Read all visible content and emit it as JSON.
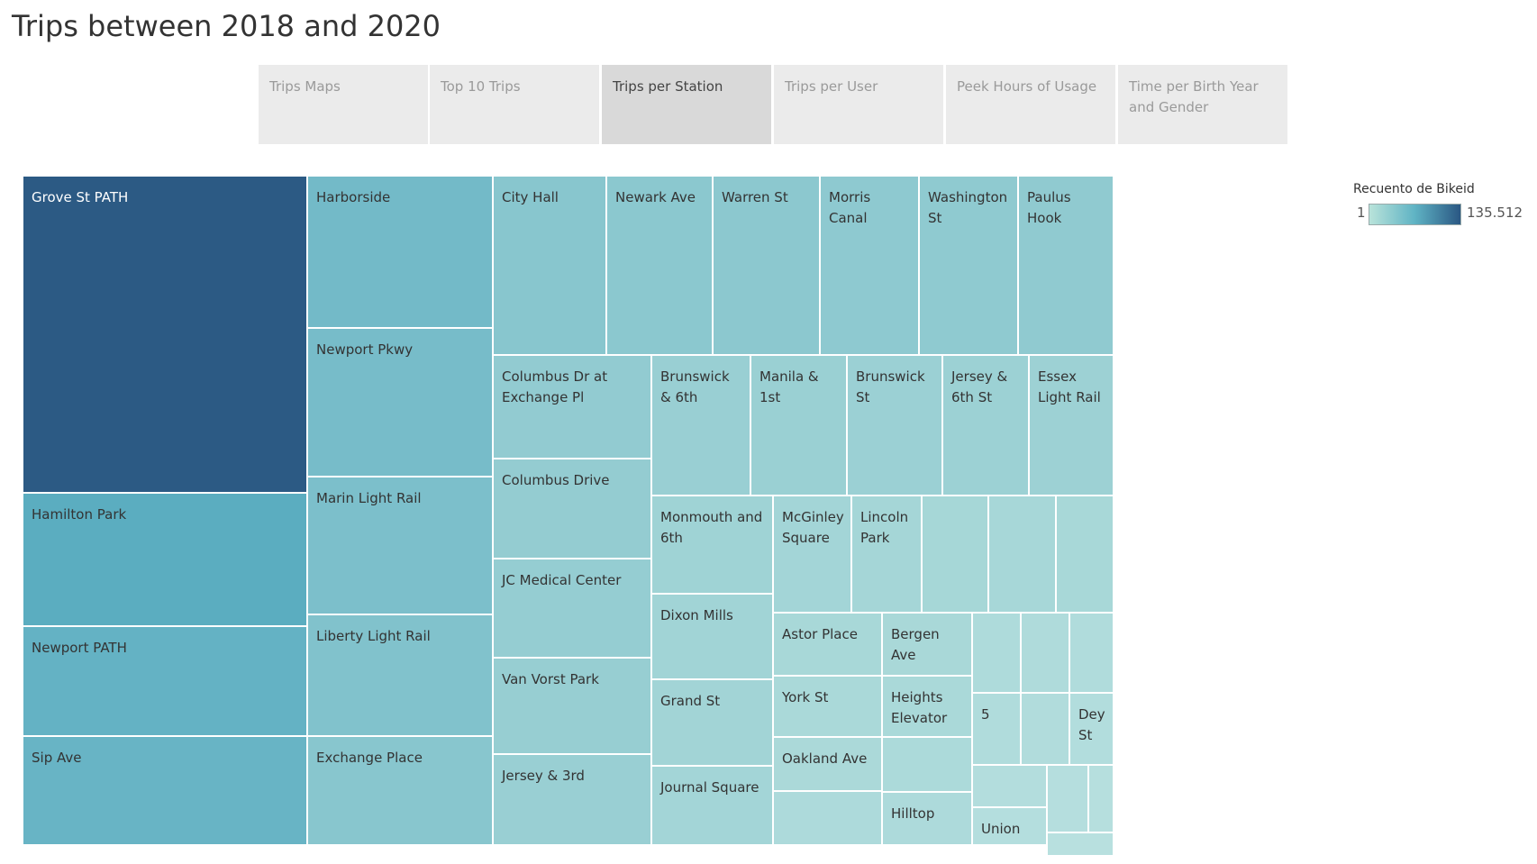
{
  "title": "Trips between 2018 and 2020",
  "tabs": [
    {
      "label": "Trips Maps",
      "active": false
    },
    {
      "label": "Top 10 Trips",
      "active": false
    },
    {
      "label": "Trips per Station",
      "active": true
    },
    {
      "label": "Trips per User",
      "active": false
    },
    {
      "label": "Peek Hours of Usage",
      "active": false
    },
    {
      "label": "Time per Birth Year and Gender",
      "active": false
    }
  ],
  "legend": {
    "title": "Recuento de Bikeid",
    "min": "1",
    "max": "135.512",
    "color_low": "#b9e3da",
    "color_high": "#2a5783"
  },
  "stations": [
    "Grove St PATH",
    "Hamilton Park",
    "Newport PATH",
    "Sip Ave",
    "Harborside",
    "Newport Pkwy",
    "Marin Light Rail",
    "Liberty Light Rail",
    "Exchange Place",
    "City Hall",
    "Newark Ave",
    "Warren St",
    "Morris Canal",
    "Washington St",
    "Paulus Hook",
    "Columbus Dr at Exchange Pl",
    "Columbus Drive",
    "JC Medical Center",
    "Van Vorst Park",
    "Jersey & 3rd",
    "Brunswick & 6th",
    "Manila & 1st",
    "Brunswick St",
    "Jersey & 6th St",
    "Essex Light Rail",
    "Monmouth and 6th",
    "Dixon Mills",
    "Grand St",
    "Journal Square",
    "McGinley Square",
    "Lincoln Park",
    "Astor Place",
    "Bergen Ave",
    "York St",
    "Heights Elevator",
    "Oakland Ave",
    "Hilltop",
    "5",
    "Dey St",
    "Union St",
    "",
    "",
    "",
    "",
    "",
    "",
    "",
    "",
    "",
    "",
    "",
    "",
    ""
  ]
}
